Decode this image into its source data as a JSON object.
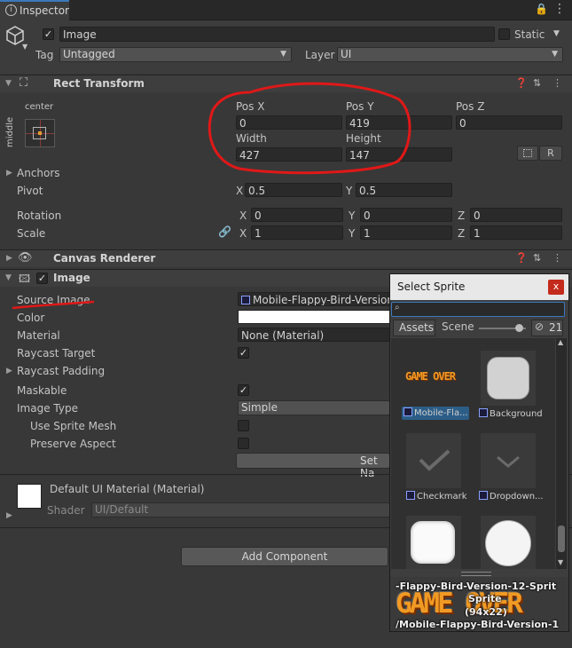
{
  "tab": {
    "title": "Inspector"
  },
  "object": {
    "name": "Image",
    "active": true,
    "static_label": "Static",
    "tag_label": "Tag",
    "tag_value": "Untagged",
    "layer_label": "Layer",
    "layer_value": "UI"
  },
  "rect_transform": {
    "title": "Rect Transform",
    "anchor_h": "center",
    "anchor_v": "middle",
    "pos_x_label": "Pos X",
    "pos_x": "0",
    "pos_y_label": "Pos Y",
    "pos_y": "419",
    "pos_z_label": "Pos Z",
    "pos_z": "0",
    "width_label": "Width",
    "width": "427",
    "height_label": "Height",
    "height": "147",
    "r_button": "R",
    "anchors_label": "Anchors",
    "pivot_label": "Pivot",
    "pivot_x": "0.5",
    "pivot_y": "0.5",
    "rotation_label": "Rotation",
    "rot_x": "0",
    "rot_y": "0",
    "rot_z": "0",
    "scale_label": "Scale",
    "scale_x": "1",
    "scale_y": "1",
    "scale_z": "1",
    "axis_x": "X",
    "axis_y": "Y",
    "axis_z": "Z"
  },
  "canvas_renderer": {
    "title": "Canvas Renderer"
  },
  "image_component": {
    "title": "Image",
    "source_image_label": "Source Image",
    "source_image_value": "Mobile-Flappy-Bird-Version",
    "color_label": "Color",
    "material_label": "Material",
    "material_value": "None (Material)",
    "raycast_target_label": "Raycast Target",
    "raycast_padding_label": "Raycast Padding",
    "maskable_label": "Maskable",
    "image_type_label": "Image Type",
    "image_type_value": "Simple",
    "use_sprite_mesh_label": "Use Sprite Mesh",
    "preserve_aspect_label": "Preserve Aspect",
    "set_native_label": "Set Na"
  },
  "material_block": {
    "title": "Default UI Material (Material)",
    "shader_label": "Shader",
    "shader_value": "UI/Default"
  },
  "add_component_label": "Add Component",
  "sprite_picker": {
    "title": "Select Sprite",
    "close": "x",
    "search_value": "",
    "tab_assets": "Assets",
    "tab_scene": "Scene",
    "hidden_count": "21",
    "zoom_level": 0.85,
    "items": [
      {
        "label": "Mobile-Fla...",
        "art": "GAME OVER",
        "selected": true
      },
      {
        "label": "Background"
      },
      {
        "label": "Checkmark"
      },
      {
        "label": "Dropdown..."
      }
    ],
    "preview_name": "-Flappy-Bird-Version-12-Sprit",
    "preview_type": "Sprite",
    "preview_size": "(94x22)",
    "preview_path": "/Mobile-Flappy-Bird-Version-1",
    "preview_art": "GAME OVER"
  },
  "colors": {
    "annotation": "#e01818",
    "sprite_art": "#f09a24",
    "selected": "#2c5d87"
  }
}
